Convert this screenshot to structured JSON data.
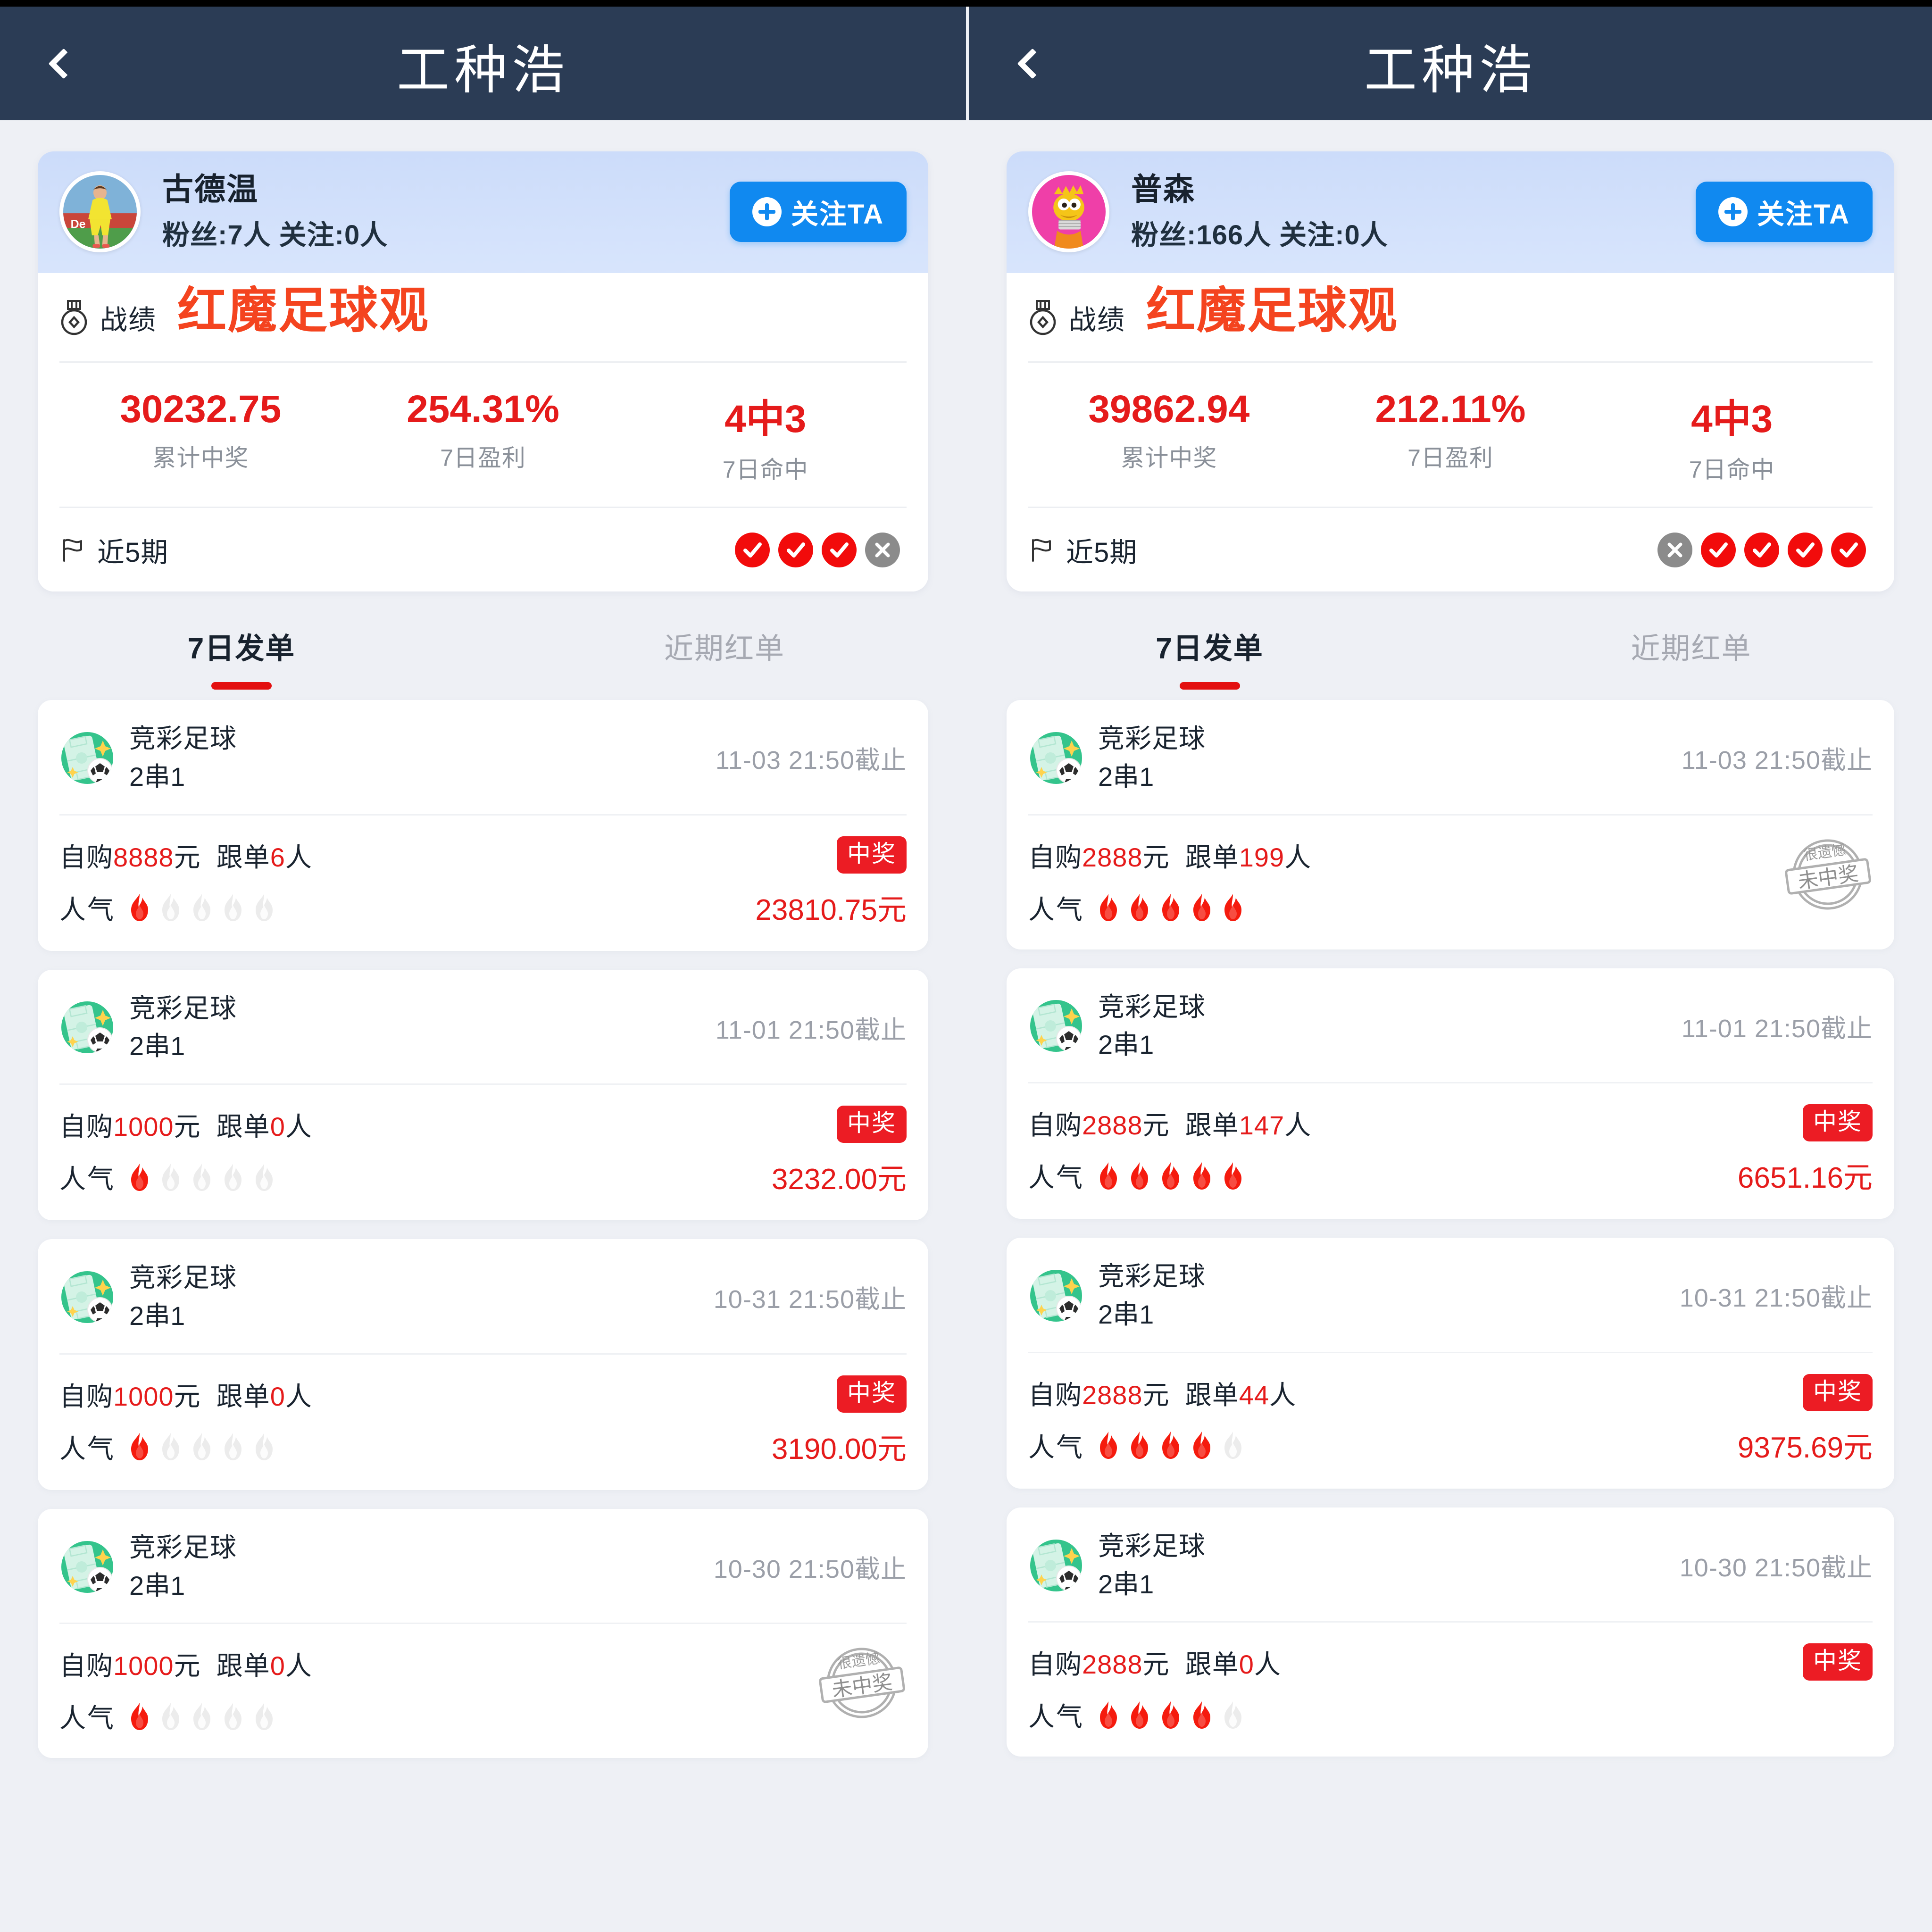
{
  "header": {
    "title": "工种浩",
    "back_icon": "chevron-left-icon"
  },
  "labels": {
    "record_section": "战绩",
    "watermark": "红魔足球观",
    "recent_label": "近5期",
    "follow_button": "关注TA",
    "popularity": "人气",
    "win_badge": "中奖",
    "lose_stamp_top": "很遗憾",
    "lose_stamp_bottom": "未中奖"
  },
  "colors": {
    "header_bg": "#2b3c55",
    "accent_red": "#e51b1b",
    "badge_red": "#ec1c24",
    "follow_blue": "#1089f0",
    "watermark_red": "#f4441f",
    "page_bg": "#eef0f5"
  },
  "panels": [
    {
      "profile": {
        "name": "古德温",
        "stats": "粉丝:7人 关注:0人",
        "avatar_name": "avatar-footballer"
      },
      "record": {
        "stats": [
          {
            "value": "30232.75",
            "label": "累计中奖"
          },
          {
            "value": "254.31%",
            "label": "7日盈利"
          },
          {
            "value": "4中3",
            "label": "7日命中"
          }
        ],
        "recent": [
          "win",
          "win",
          "win",
          "lose"
        ]
      },
      "tabs": [
        {
          "label": "7日发单",
          "active": true
        },
        {
          "label": "近期红单",
          "active": false
        }
      ],
      "orders": [
        {
          "game": "竞彩足球",
          "type": "2串1",
          "deadline": "11-03 21:50截止",
          "buy_prefix": "自购",
          "buy_amount": "8888",
          "buy_unit": "元",
          "follow_prefix": "跟单",
          "follow_count": "6",
          "follow_unit": "人",
          "flames_lit": 1,
          "flames_total": 5,
          "result": "win",
          "amount": "23810.75元"
        },
        {
          "game": "竞彩足球",
          "type": "2串1",
          "deadline": "11-01 21:50截止",
          "buy_prefix": "自购",
          "buy_amount": "1000",
          "buy_unit": "元",
          "follow_prefix": "跟单",
          "follow_count": "0",
          "follow_unit": "人",
          "flames_lit": 1,
          "flames_total": 5,
          "result": "win",
          "amount": "3232.00元"
        },
        {
          "game": "竞彩足球",
          "type": "2串1",
          "deadline": "10-31 21:50截止",
          "buy_prefix": "自购",
          "buy_amount": "1000",
          "buy_unit": "元",
          "follow_prefix": "跟单",
          "follow_count": "0",
          "follow_unit": "人",
          "flames_lit": 1,
          "flames_total": 5,
          "result": "win",
          "amount": "3190.00元"
        },
        {
          "game": "竞彩足球",
          "type": "2串1",
          "deadline": "10-30 21:50截止",
          "buy_prefix": "自购",
          "buy_amount": "1000",
          "buy_unit": "元",
          "follow_prefix": "跟单",
          "follow_count": "0",
          "follow_unit": "人",
          "flames_lit": 1,
          "flames_total": 5,
          "result": "lose",
          "amount": ""
        }
      ]
    },
    {
      "profile": {
        "name": "普森",
        "stats": "粉丝:166人 关注:0人",
        "avatar_name": "avatar-cartoon"
      },
      "record": {
        "stats": [
          {
            "value": "39862.94",
            "label": "累计中奖"
          },
          {
            "value": "212.11%",
            "label": "7日盈利"
          },
          {
            "value": "4中3",
            "label": "7日命中"
          }
        ],
        "recent": [
          "lose",
          "win",
          "win",
          "win",
          "win"
        ]
      },
      "tabs": [
        {
          "label": "7日发单",
          "active": true
        },
        {
          "label": "近期红单",
          "active": false
        }
      ],
      "orders": [
        {
          "game": "竞彩足球",
          "type": "2串1",
          "deadline": "11-03 21:50截止",
          "buy_prefix": "自购",
          "buy_amount": "2888",
          "buy_unit": "元",
          "follow_prefix": "跟单",
          "follow_count": "199",
          "follow_unit": "人",
          "flames_lit": 5,
          "flames_total": 5,
          "result": "lose",
          "amount": ""
        },
        {
          "game": "竞彩足球",
          "type": "2串1",
          "deadline": "11-01 21:50截止",
          "buy_prefix": "自购",
          "buy_amount": "2888",
          "buy_unit": "元",
          "follow_prefix": "跟单",
          "follow_count": "147",
          "follow_unit": "人",
          "flames_lit": 5,
          "flames_total": 5,
          "result": "win",
          "amount": "6651.16元"
        },
        {
          "game": "竞彩足球",
          "type": "2串1",
          "deadline": "10-31 21:50截止",
          "buy_prefix": "自购",
          "buy_amount": "2888",
          "buy_unit": "元",
          "follow_prefix": "跟单",
          "follow_count": "44",
          "follow_unit": "人",
          "flames_lit": 4,
          "flames_total": 5,
          "result": "win",
          "amount": "9375.69元"
        },
        {
          "game": "竞彩足球",
          "type": "2串1",
          "deadline": "10-30 21:50截止",
          "buy_prefix": "自购",
          "buy_amount": "2888",
          "buy_unit": "元",
          "follow_prefix": "跟单",
          "follow_count": "0",
          "follow_unit": "人",
          "flames_lit": 4,
          "flames_total": 5,
          "result": "win",
          "amount": ""
        }
      ]
    }
  ]
}
